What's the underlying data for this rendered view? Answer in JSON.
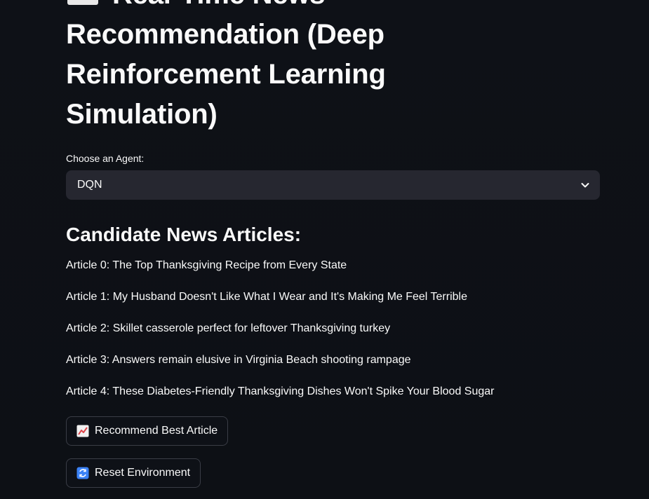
{
  "app": {
    "title": "Real-Time News Recommendation (Deep Reinforcement Learning Simulation)",
    "title_icon": "newspaper-icon"
  },
  "agent_select": {
    "label": "Choose an Agent:",
    "value": "DQN",
    "icon": "chevron-down-icon"
  },
  "candidates": {
    "heading": "Candidate News Articles:",
    "articles": [
      "Article 0: The Top Thanksgiving Recipe from Every State",
      "Article 1: My Husband Doesn't Like What I Wear and It's Making Me Feel Terrible",
      "Article 2: Skillet casserole perfect for leftover Thanksgiving turkey",
      "Article 3: Answers remain elusive in Virginia Beach shooting rampage",
      "Article 4: These Diabetes-Friendly Thanksgiving Dishes Won't Spike Your Blood Sugar"
    ]
  },
  "actions": {
    "recommend_label": "Recommend Best Article",
    "recommend_icon": "chart-increasing-icon",
    "reset_label": "Reset Environment",
    "reset_icon": "refresh-icon"
  }
}
